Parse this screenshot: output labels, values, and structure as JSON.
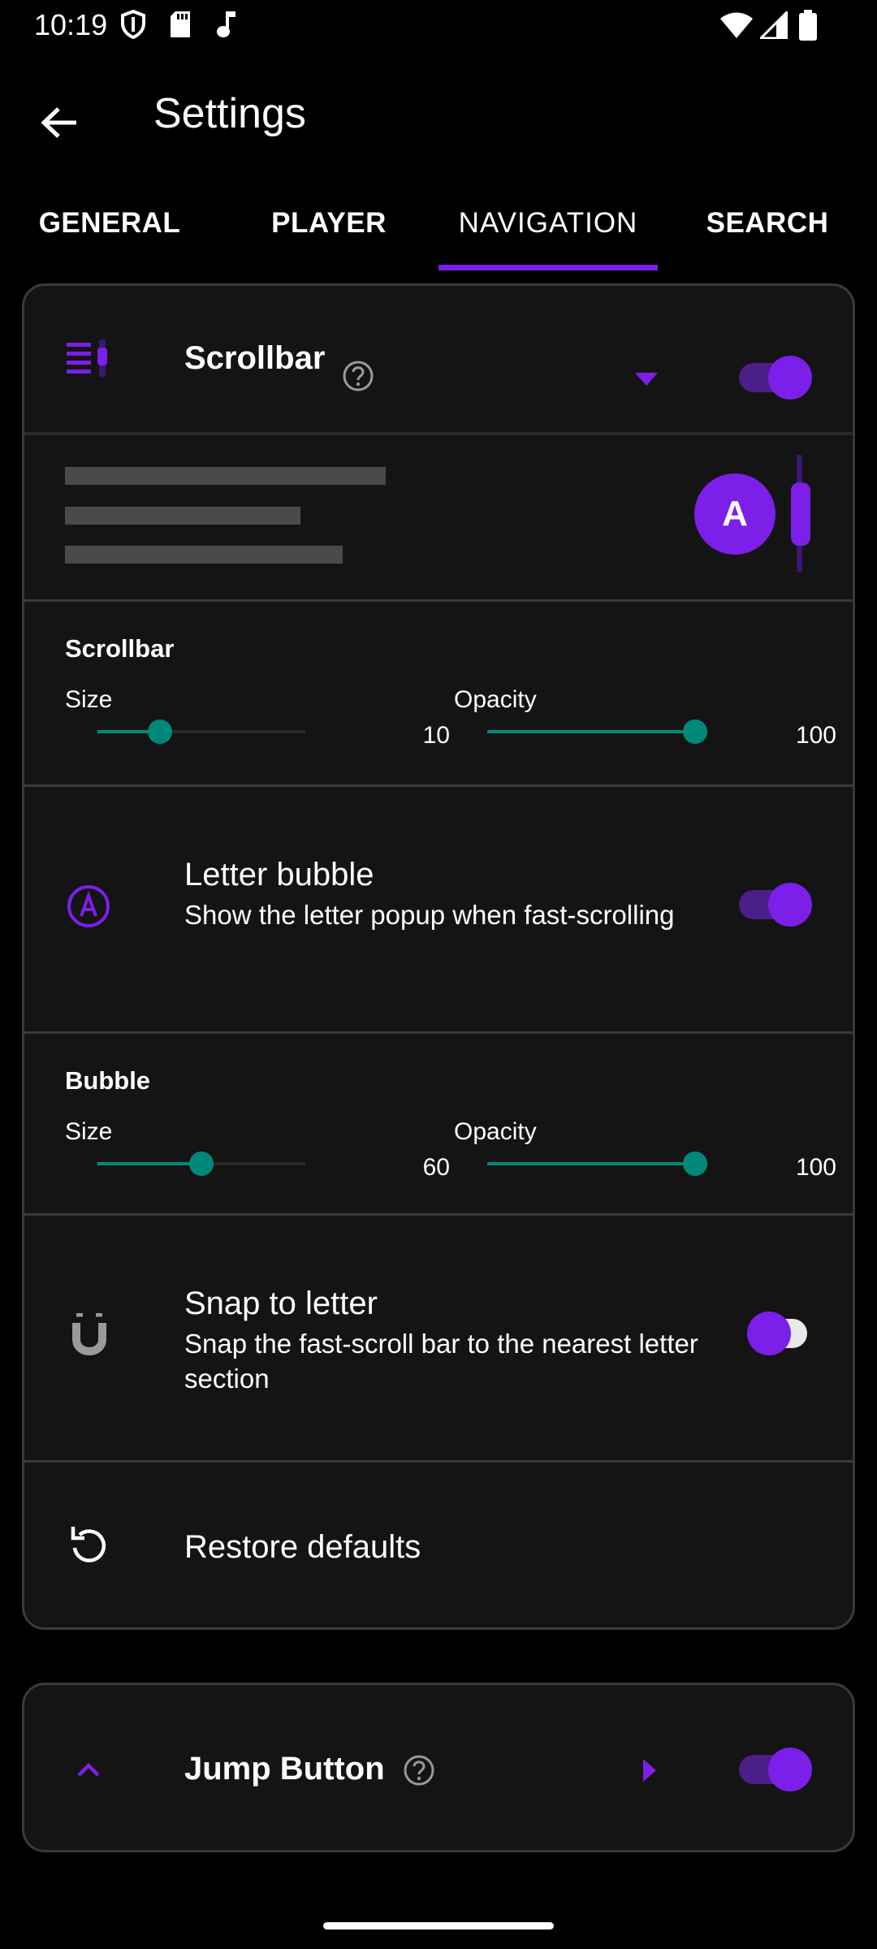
{
  "status_bar": {
    "time": "10:19",
    "left_icons": [
      "shield-icon",
      "sd-card-icon",
      "music-note-icon"
    ],
    "right_icons": [
      "wifi-icon",
      "signal-icon",
      "battery-icon"
    ]
  },
  "app_bar": {
    "back_icon": "arrow-back-icon",
    "title": "Settings"
  },
  "tabs": [
    {
      "label": "GENERAL",
      "active": false
    },
    {
      "label": "PLAYER",
      "active": false
    },
    {
      "label": "NAVIGATION",
      "active": true
    },
    {
      "label": "SEARCH",
      "active": false
    }
  ],
  "scrollbar_card": {
    "header": {
      "icon": "scrollbar-icon",
      "title": "Scrollbar",
      "help_icon": "help-circle-icon",
      "expand_icon": "caret-down-icon",
      "enabled": true
    },
    "preview": {
      "bubble_letter": "A"
    },
    "scrollbar_settings": {
      "heading": "Scrollbar",
      "size_label": "Size",
      "size_value": "10",
      "size_fraction": 0.3,
      "opacity_label": "Opacity",
      "opacity_value": "100",
      "opacity_fraction": 1.0
    },
    "letter_bubble": {
      "icon": "letter-a-circle-icon",
      "title": "Letter bubble",
      "subtitle": "Show the letter popup when fast-scrolling",
      "enabled": true
    },
    "bubble_settings": {
      "heading": "Bubble",
      "size_label": "Size",
      "size_value": "60",
      "size_fraction": 0.5,
      "opacity_label": "Opacity",
      "opacity_value": "100",
      "opacity_fraction": 1.0
    },
    "snap_to_letter": {
      "icon": "magnet-icon",
      "title": "Snap to letter",
      "subtitle": "Snap the fast-scroll bar to the nearest letter section",
      "enabled": false
    },
    "restore": {
      "icon": "restore-icon",
      "label": "Restore defaults"
    }
  },
  "jump_button_card": {
    "icon": "chevron-up-icon",
    "title": "Jump Button",
    "help_icon": "help-circle-icon",
    "expand_icon": "caret-right-icon",
    "enabled": true
  },
  "colors": {
    "accent": "#7c1fe8",
    "slider": "#00897b",
    "card_bg": "#141414",
    "background": "#000000"
  }
}
